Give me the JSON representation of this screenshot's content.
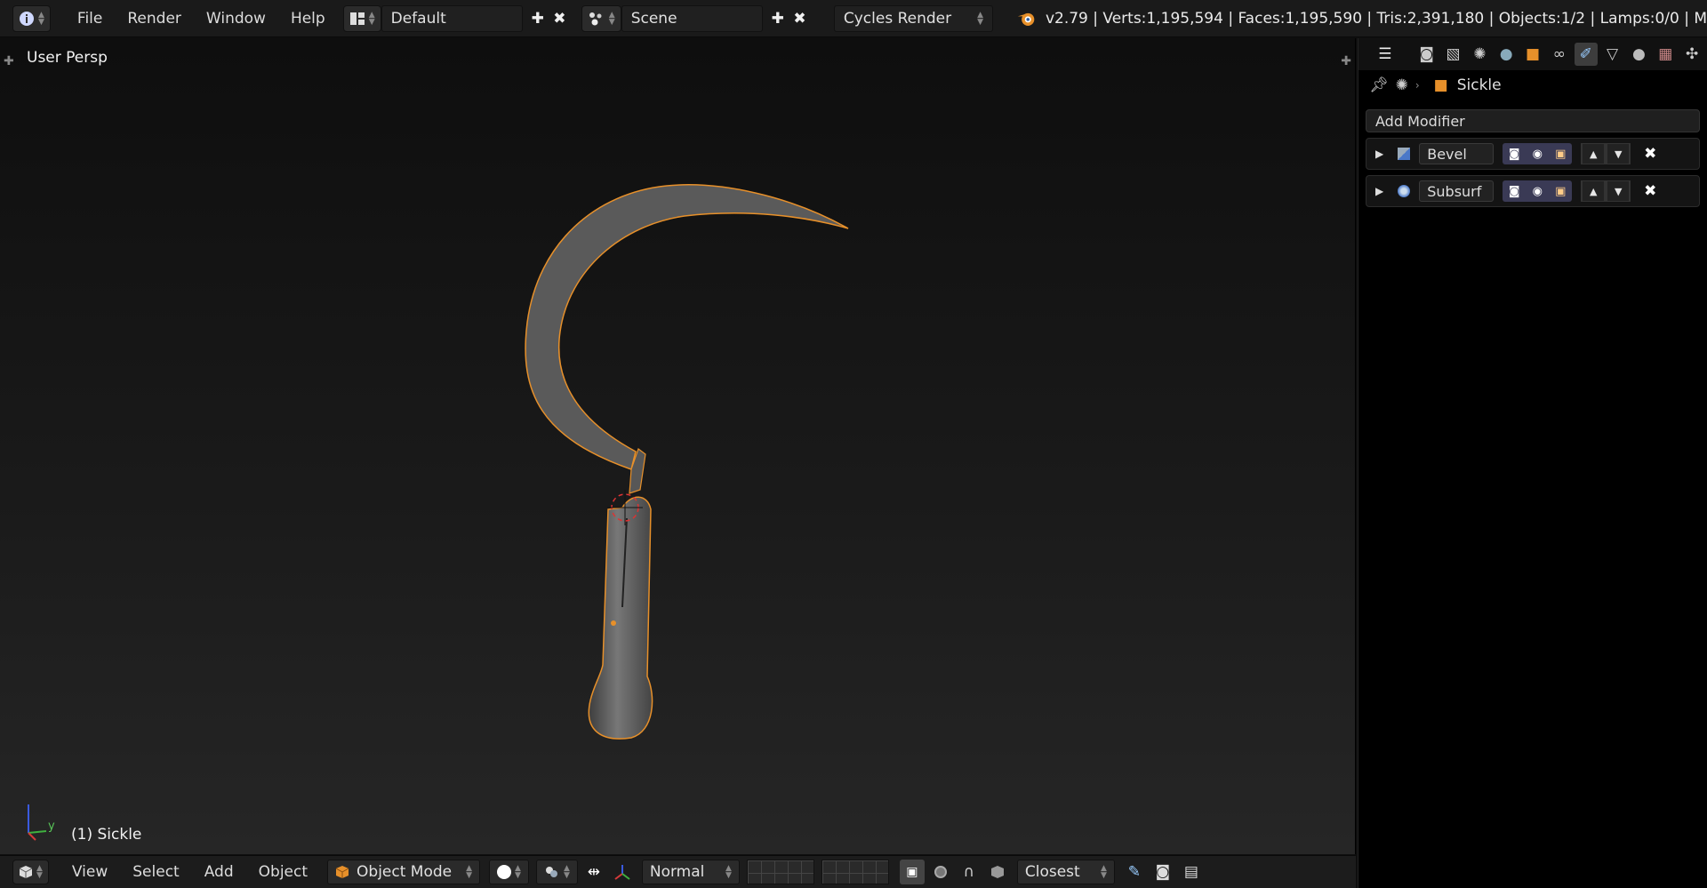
{
  "header": {
    "menus": [
      "File",
      "Render",
      "Window",
      "Help"
    ],
    "layout": "Default",
    "scene": "Scene",
    "engine": "Cycles Render",
    "stats": "v2.79 | Verts:1,195,594 | Faces:1,195,590 | Tris:2,391,180 | Objects:1/2 | Lamps:0/0 | M"
  },
  "viewport": {
    "view_label": "User Persp",
    "object_label": "(1) Sickle",
    "axis_y": "y"
  },
  "bottom": {
    "menus": [
      "View",
      "Select",
      "Add",
      "Object"
    ],
    "mode": "Object Mode",
    "orientation": "Normal",
    "snap": "Closest"
  },
  "properties": {
    "breadcrumb": "Sickle",
    "add_modifier": "Add Modifier",
    "modifiers": [
      "Bevel",
      "Subsurf"
    ]
  },
  "colors": {
    "accent": "#e7902a",
    "mesh": "#5a5a5a",
    "active_vis": "#3a3a55"
  }
}
